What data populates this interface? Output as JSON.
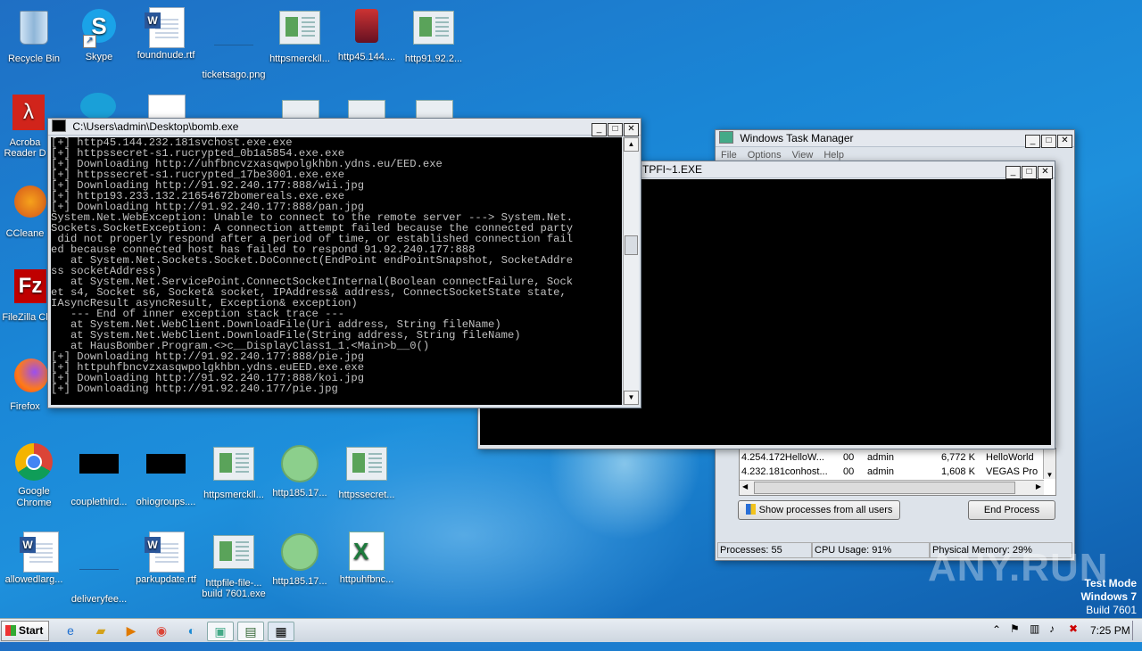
{
  "desktop": {
    "icons": [
      {
        "label": "Recycle Bin"
      },
      {
        "label": "Skype"
      },
      {
        "label": "foundnude.rtf"
      },
      {
        "label": "ticketsago.png"
      },
      {
        "label": "httpsmerckll..."
      },
      {
        "label": "http45.144...."
      },
      {
        "label": "http91.92.2..."
      },
      {
        "label": "Acroba Reader D"
      },
      {
        "label": "CCleane"
      },
      {
        "label": "FileZilla Cl"
      },
      {
        "label": "Firefox"
      },
      {
        "label": "Google Chrome"
      },
      {
        "label": "couplethird..."
      },
      {
        "label": "ohiogroups...."
      },
      {
        "label": "httpsmerckll..."
      },
      {
        "label": "http185.17..."
      },
      {
        "label": "httpssecret..."
      },
      {
        "label": "allowedlarg..."
      },
      {
        "label": "deliveryfee..."
      },
      {
        "label": "parkupdate.rtf"
      },
      {
        "label": "httpfile-file-..."
      },
      {
        "label": "http185.17..."
      },
      {
        "label": "httpuhfbnc..."
      }
    ],
    "build_overlay": "build 7601.exe"
  },
  "console_window": {
    "title": "C:\\Users\\admin\\Desktop\\bomb.exe",
    "lines": [
      "[+] http45.144.232.181svchost.exe.exe",
      "[+] httpssecret-s1.rucrypted_0b1a5854.exe.exe",
      "[+] Downloading http://uhfbncvzxasqwpolgkhbn.ydns.eu/EED.exe",
      "[+] httpssecret-s1.rucrypted_17be3001.exe.exe",
      "[+] Downloading http://91.92.240.177:888/wii.jpg",
      "[+] http193.233.132.21654672bomereals.exe.exe",
      "[+] Downloading http://91.92.240.177:888/pan.jpg",
      "System.Net.WebException: Unable to connect to the remote server ---> System.Net.",
      "Sockets.SocketException: A connection attempt failed because the connected party",
      " did not properly respond after a period of time, or established connection fail",
      "ed because connected host has failed to respond 91.92.240.177:888",
      "   at System.Net.Sockets.Socket.DoConnect(EndPoint endPointSnapshot, SocketAddre",
      "ss socketAddress)",
      "   at System.Net.ServicePoint.ConnectSocketInternal(Boolean connectFailure, Sock",
      "et s4, Socket s6, Socket& socket, IPAddress& address, ConnectSocketState state,",
      "IAsyncResult asyncResult, Exception& exception)",
      "   --- End of inner exception stack trace ---",
      "   at System.Net.WebClient.DownloadFile(Uri address, String fileName)",
      "   at System.Net.WebClient.DownloadFile(String address, String fileName)",
      "   at HausBomber.Program.<>c__DisplayClass1_1.<Main>b__0()",
      "[+] Downloading http://91.92.240.177:888/pie.jpg",
      "[+] httpuhfbncvzxasqwpolgkhbn.ydns.euEED.exe.exe",
      "[+] Downloading http://91.92.240.177:888/koi.jpg",
      "[+] Downloading http://91.92.240.177/pie.jpg"
    ]
  },
  "console_window_2": {
    "title": "TPFI~1.EXE"
  },
  "task_manager": {
    "title": "Windows Task Manager",
    "menu": [
      "File",
      "Options",
      "View",
      "Help"
    ],
    "rows": [
      {
        "name": "4.254.172HelloW...",
        "cpu": "00",
        "user": "admin",
        "mem": "6,772 K",
        "desc": "HelloWorld"
      },
      {
        "name": "4.232.181conhost...",
        "cpu": "00",
        "user": "admin",
        "mem": "1,608 K",
        "desc": "VEGAS Pro"
      }
    ],
    "show_all_label": "Show processes from all users",
    "end_process_label": "End Process",
    "status": {
      "processes": "Processes: 55",
      "cpu": "CPU Usage: 91%",
      "memory": "Physical Memory: 29%"
    }
  },
  "watermark": {
    "brand": "ANY.RUN",
    "test_mode": "Test Mode",
    "os": "Windows 7",
    "build": "Build 7601"
  },
  "taskbar": {
    "start_label": "Start",
    "clock": "7:25 PM"
  }
}
